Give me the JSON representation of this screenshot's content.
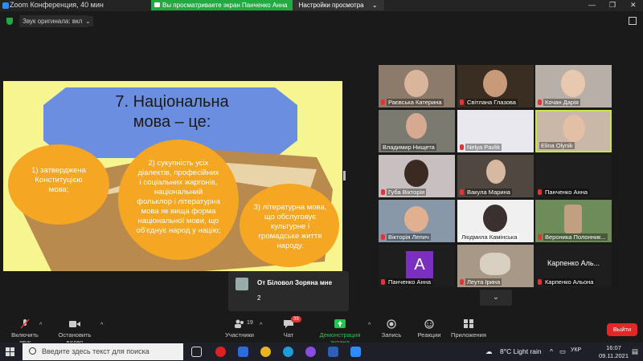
{
  "window": {
    "title": "Zoom Конференция, 40 мин",
    "min": "—",
    "restore": "❐",
    "close": "✕"
  },
  "share_banner": {
    "text": "Вы просматриваете экран Панченко Анна",
    "options_label": "Настройки просмотра",
    "options_caret": "⌄"
  },
  "audio_toggle": {
    "label": "Звук оригинала: вкл.",
    "caret": "⌄"
  },
  "slide": {
    "title_line1": "7. Національна",
    "title_line2": "мова – це:",
    "point1": [
      "1) затверджена",
      "Конституцією",
      "мова;"
    ],
    "point2": [
      "2) сукупність усіх",
      "діалектів, професійних",
      "і соціальних жаргонів,",
      "національний",
      "фольклор і літературна",
      "мова як вища форма",
      "національної мови, що",
      "об'єднує народ у націю;"
    ],
    "point3": [
      "3) літературна мова,",
      "що обслуговує",
      "культурне і",
      "громадське життя",
      "народу."
    ],
    "colors": {
      "background": "#f6f590",
      "octagon": "#6b8ee0",
      "circle": "#f5a623",
      "book": "#b98a4e"
    }
  },
  "participants": [
    {
      "name": "Раєвська Катерина",
      "muted": true
    },
    {
      "name": "Світлана Глазова",
      "muted": true
    },
    {
      "name": "Кочан Дарія",
      "muted": true
    },
    {
      "name": "Владимир Нищета",
      "muted": false
    },
    {
      "name": "Nelya Pavlik",
      "muted": true
    },
    {
      "name": "Elina Olynik",
      "muted": false
    },
    {
      "name": "Губа Вікторія",
      "muted": true
    },
    {
      "name": "Вакула Марина",
      "muted": true
    },
    {
      "name": "Панченко Анна",
      "muted": true
    },
    {
      "name": "Вікторія Лепич",
      "muted": true
    },
    {
      "name": "Людмила Камінська",
      "muted": false
    },
    {
      "name": "Вероника Полонник...",
      "muted": true
    },
    {
      "name": "Панченко Анна",
      "muted": true,
      "avatar_letter": "A"
    },
    {
      "name": "Леута Ірина",
      "muted": true
    },
    {
      "name": "Карпенко Альона",
      "muted": true,
      "display_name": "Карпенко Аль..."
    }
  ],
  "scroll_down": "⌄",
  "chat_popup": {
    "from": "От Біловол Зоряна мне",
    "message": "2"
  },
  "bottom_bar": {
    "unmute": "Включить звук",
    "start_video": "Остановить видео",
    "participants": "Участники",
    "participants_count": "19",
    "chat": "Чат",
    "chat_badge": "39",
    "share": "Демонстрация экрана",
    "record": "Запись",
    "reactions": "Реакции",
    "apps": "Приложения",
    "leave": "Выйти",
    "caret": "^"
  },
  "taskbar": {
    "search_placeholder": "Введите здесь текст для поиска",
    "weather": "8°C  Light rain",
    "tray_arrow": "^",
    "language": "УКР",
    "time": "16:07",
    "date": "09.11.2021"
  }
}
